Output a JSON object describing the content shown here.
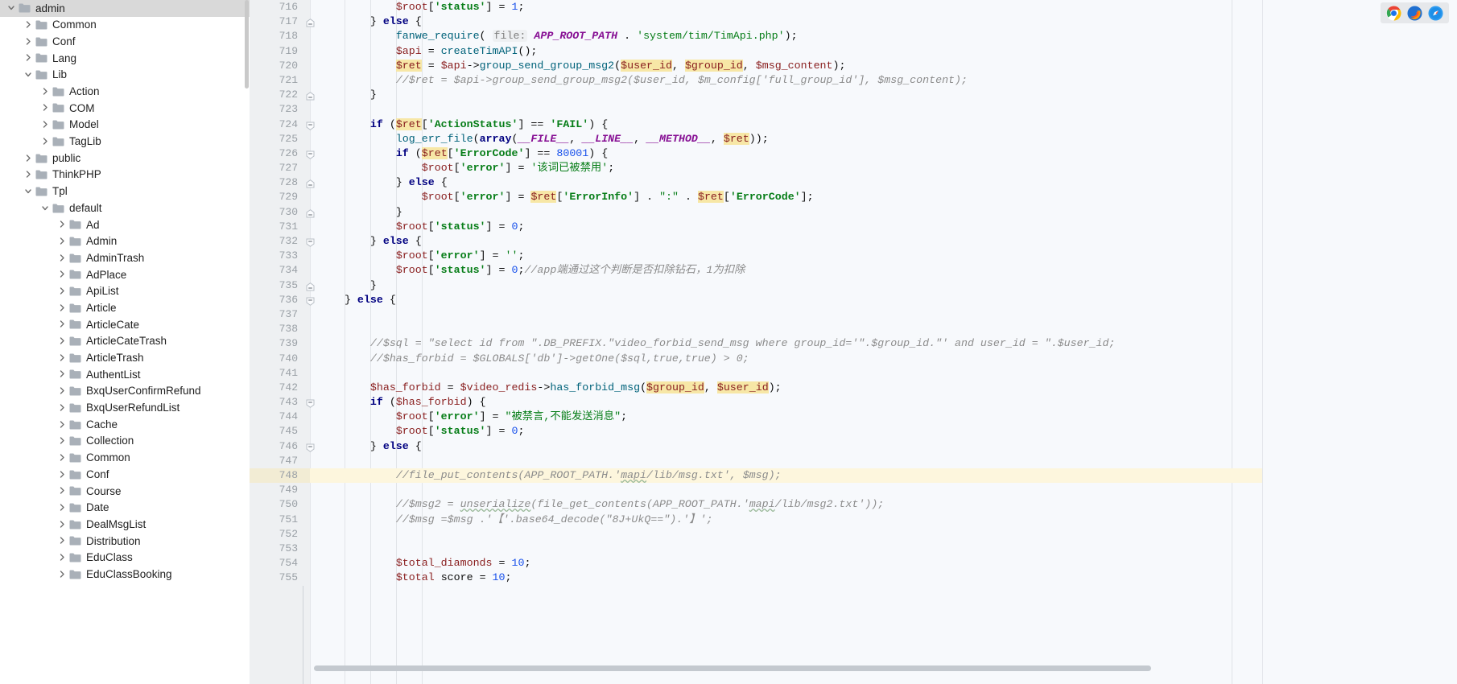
{
  "sidebar": {
    "name": "project-tree",
    "scrollbar": "vertical-scrollbar",
    "items": [
      {
        "label": "admin",
        "depth": 0,
        "state": "expanded",
        "selected": true
      },
      {
        "label": "Common",
        "depth": 1,
        "state": "collapsed",
        "selected": false
      },
      {
        "label": "Conf",
        "depth": 1,
        "state": "collapsed",
        "selected": false
      },
      {
        "label": "Lang",
        "depth": 1,
        "state": "collapsed",
        "selected": false
      },
      {
        "label": "Lib",
        "depth": 1,
        "state": "expanded",
        "selected": false
      },
      {
        "label": "Action",
        "depth": 2,
        "state": "collapsed",
        "selected": false
      },
      {
        "label": "COM",
        "depth": 2,
        "state": "collapsed",
        "selected": false
      },
      {
        "label": "Model",
        "depth": 2,
        "state": "collapsed",
        "selected": false
      },
      {
        "label": "TagLib",
        "depth": 2,
        "state": "collapsed",
        "selected": false
      },
      {
        "label": "public",
        "depth": 1,
        "state": "collapsed",
        "selected": false
      },
      {
        "label": "ThinkPHP",
        "depth": 1,
        "state": "collapsed",
        "selected": false
      },
      {
        "label": "Tpl",
        "depth": 1,
        "state": "expanded",
        "selected": false
      },
      {
        "label": "default",
        "depth": 2,
        "state": "expanded",
        "selected": false
      },
      {
        "label": "Ad",
        "depth": 3,
        "state": "collapsed",
        "selected": false
      },
      {
        "label": "Admin",
        "depth": 3,
        "state": "collapsed",
        "selected": false
      },
      {
        "label": "AdminTrash",
        "depth": 3,
        "state": "collapsed",
        "selected": false
      },
      {
        "label": "AdPlace",
        "depth": 3,
        "state": "collapsed",
        "selected": false
      },
      {
        "label": "ApiList",
        "depth": 3,
        "state": "collapsed",
        "selected": false
      },
      {
        "label": "Article",
        "depth": 3,
        "state": "collapsed",
        "selected": false
      },
      {
        "label": "ArticleCate",
        "depth": 3,
        "state": "collapsed",
        "selected": false
      },
      {
        "label": "ArticleCateTrash",
        "depth": 3,
        "state": "collapsed",
        "selected": false
      },
      {
        "label": "ArticleTrash",
        "depth": 3,
        "state": "collapsed",
        "selected": false
      },
      {
        "label": "AuthentList",
        "depth": 3,
        "state": "collapsed",
        "selected": false
      },
      {
        "label": "BxqUserConfirmRefund",
        "depth": 3,
        "state": "collapsed",
        "selected": false
      },
      {
        "label": "BxqUserRefundList",
        "depth": 3,
        "state": "collapsed",
        "selected": false
      },
      {
        "label": "Cache",
        "depth": 3,
        "state": "collapsed",
        "selected": false
      },
      {
        "label": "Collection",
        "depth": 3,
        "state": "collapsed",
        "selected": false
      },
      {
        "label": "Common",
        "depth": 3,
        "state": "collapsed",
        "selected": false
      },
      {
        "label": "Conf",
        "depth": 3,
        "state": "collapsed",
        "selected": false
      },
      {
        "label": "Course",
        "depth": 3,
        "state": "collapsed",
        "selected": false
      },
      {
        "label": "Date",
        "depth": 3,
        "state": "collapsed",
        "selected": false
      },
      {
        "label": "DealMsgList",
        "depth": 3,
        "state": "collapsed",
        "selected": false
      },
      {
        "label": "Distribution",
        "depth": 3,
        "state": "collapsed",
        "selected": false
      },
      {
        "label": "EduClass",
        "depth": 3,
        "state": "collapsed",
        "selected": false
      },
      {
        "label": "EduClassBooking",
        "depth": 3,
        "state": "collapsed",
        "selected": false
      }
    ]
  },
  "editor": {
    "name": "php-code-editor",
    "language": "PHP",
    "first_line_number": 716,
    "last_line_number": 755,
    "caret_line": 748,
    "highlighted_tokens": [
      "$ret",
      "$group_id",
      "$user_id"
    ],
    "lines": [
      {
        "n": 716,
        "fold": "",
        "indent": 3
      },
      {
        "n": 717,
        "fold": "end",
        "indent": 2
      },
      {
        "n": 718,
        "fold": "",
        "indent": 3
      },
      {
        "n": 719,
        "fold": "",
        "indent": 3
      },
      {
        "n": 720,
        "fold": "",
        "indent": 3
      },
      {
        "n": 721,
        "fold": "",
        "indent": 3
      },
      {
        "n": 722,
        "fold": "end",
        "indent": 2
      },
      {
        "n": 723,
        "fold": "",
        "indent": 0
      },
      {
        "n": 724,
        "fold": "start",
        "indent": 2
      },
      {
        "n": 725,
        "fold": "",
        "indent": 3
      },
      {
        "n": 726,
        "fold": "start",
        "indent": 3
      },
      {
        "n": 727,
        "fold": "",
        "indent": 4
      },
      {
        "n": 728,
        "fold": "end",
        "indent": 3
      },
      {
        "n": 729,
        "fold": "",
        "indent": 4
      },
      {
        "n": 730,
        "fold": "end",
        "indent": 3
      },
      {
        "n": 731,
        "fold": "",
        "indent": 3
      },
      {
        "n": 732,
        "fold": "start",
        "indent": 2
      },
      {
        "n": 733,
        "fold": "",
        "indent": 3
      },
      {
        "n": 734,
        "fold": "",
        "indent": 3
      },
      {
        "n": 735,
        "fold": "end",
        "indent": 2
      },
      {
        "n": 736,
        "fold": "start",
        "indent": 1
      },
      {
        "n": 737,
        "fold": "",
        "indent": 0
      },
      {
        "n": 738,
        "fold": "",
        "indent": 0
      },
      {
        "n": 739,
        "fold": "",
        "indent": 2
      },
      {
        "n": 740,
        "fold": "",
        "indent": 2
      },
      {
        "n": 741,
        "fold": "",
        "indent": 0
      },
      {
        "n": 742,
        "fold": "",
        "indent": 2
      },
      {
        "n": 743,
        "fold": "start",
        "indent": 2
      },
      {
        "n": 744,
        "fold": "",
        "indent": 3
      },
      {
        "n": 745,
        "fold": "",
        "indent": 3
      },
      {
        "n": 746,
        "fold": "start",
        "indent": 2
      },
      {
        "n": 747,
        "fold": "",
        "indent": 0
      },
      {
        "n": 748,
        "fold": "",
        "indent": 3
      },
      {
        "n": 749,
        "fold": "",
        "indent": 0
      },
      {
        "n": 750,
        "fold": "",
        "indent": 3
      },
      {
        "n": 751,
        "fold": "",
        "indent": 3
      },
      {
        "n": 752,
        "fold": "",
        "indent": 0
      },
      {
        "n": 753,
        "fold": "",
        "indent": 0
      },
      {
        "n": 754,
        "fold": "",
        "indent": 3
      },
      {
        "n": 755,
        "fold": "",
        "indent": 3
      }
    ],
    "source_text": [
      "            $root['status'] = 1;",
      "        } else {",
      "            fanwe_require( file: APP_ROOT_PATH . 'system/tim/TimApi.php');",
      "            $api = createTimAPI();",
      "            $ret = $api->group_send_group_msg2($user_id, $group_id, $msg_content);",
      "            //$ret = $api->group_send_group_msg2($user_id, $m_config['full_group_id'], $msg_content);",
      "        }",
      "",
      "        if ($ret['ActionStatus'] == 'FAIL') {",
      "            log_err_file(array(__FILE__, __LINE__, __METHOD__, $ret));",
      "            if ($ret['ErrorCode'] == 80001) {",
      "                $root['error'] = '该词已被禁用';",
      "            } else {",
      "                $root['error'] = $ret['ErrorInfo'] . \":\" . $ret['ErrorCode'];",
      "            }",
      "            $root['status'] = 0;",
      "        } else {",
      "            $root['error'] = '';",
      "            $root['status'] = 0;//app端通过这个判断是否扣除钻石，1为扣除",
      "        }",
      "    } else {",
      "",
      "",
      "        //$sql = \"select id from \".DB_PREFIX.\"video_forbid_send_msg where group_id='\".$group_id.\"' and user_id = \".$user_id;",
      "        //$has_forbid = $GLOBALS['db']->getOne($sql,true,true) > 0;",
      "",
      "        $has_forbid = $video_redis->has_forbid_msg($group_id, $user_id);",
      "        if ($has_forbid) {",
      "            $root['error'] = \"被禁言,不能发送消息\";",
      "            $root['status'] = 0;",
      "        } else {",
      "",
      "            //file_put_contents(APP_ROOT_PATH.'mapi/lib/msg.txt', $msg);",
      "",
      "            //$msg2 = unserialize(file_get_contents(APP_ROOT_PATH.'mapi/lib/msg2.txt'));",
      "            //$msg =$msg .'【'.base64_decode(\"8J+UkQ==\").'】';",
      "",
      "",
      "            $total_diamonds = 10;",
      "            $total score = 10;"
    ]
  },
  "right_panel": {
    "name": "browser-tray",
    "browsers": [
      {
        "name": "chrome-icon",
        "label": "Chrome",
        "color": "#4285f4"
      },
      {
        "name": "firefox-icon",
        "label": "Firefox",
        "color": "#ff7139"
      },
      {
        "name": "safari-icon",
        "label": "Safari",
        "color": "#1e90ff"
      }
    ]
  },
  "colors": {
    "editor_bg": "#f7f9fc",
    "gutter_bg": "#eef0f2",
    "caret_line_bg": "#fdf6dd",
    "selection_bg": "#d9d9d9",
    "keyword": "#000080",
    "string": "#067d17",
    "comment": "#8c8c8c",
    "number": "#1750eb",
    "variable": "#871094",
    "occurrence_highlight": "#f7e7a6"
  }
}
